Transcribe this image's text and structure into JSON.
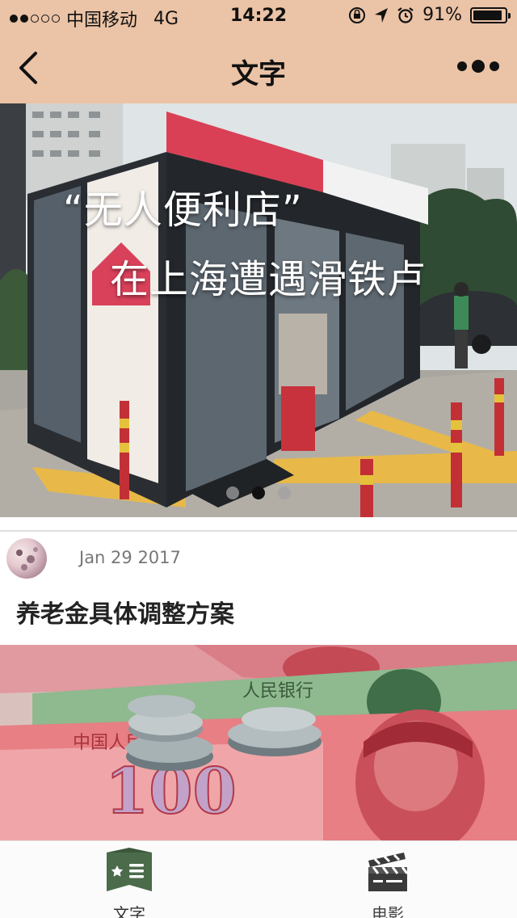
{
  "status_bar": {
    "carrier": "中国移动",
    "network": "4G",
    "time": "14:22",
    "battery": "91%",
    "battery_level": 0.91,
    "icons": [
      "signal-dots-icon",
      "orientation-lock-icon",
      "location-arrow-icon",
      "alarm-icon",
      "battery-icon"
    ]
  },
  "nav": {
    "title": "文字",
    "icons": [
      "back-chevron-icon",
      "more-dots-icon"
    ]
  },
  "banner": {
    "line1": "“无人便利店”",
    "line2": "在上海遭遇滑铁卢",
    "pager_count": 3,
    "pager_active": 2
  },
  "post": {
    "date": "Jan 29 2017",
    "title": "养老金具体调整方案"
  },
  "tabs": [
    {
      "label": "文字",
      "icon": "article-list-icon",
      "active": true
    },
    {
      "label": "电影",
      "icon": "clapperboard-icon",
      "active": false
    }
  ],
  "colors": {
    "header": "#ebc3a6",
    "tab_active": "#4b6b4b"
  }
}
